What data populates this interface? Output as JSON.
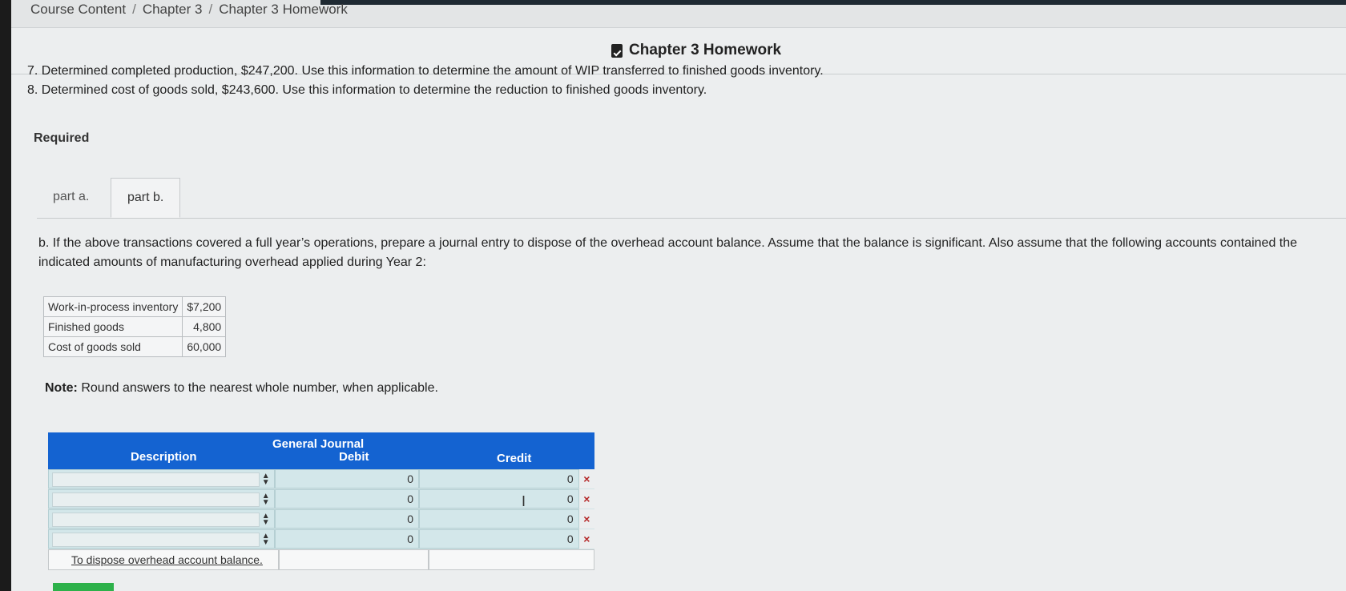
{
  "breadcrumb": {
    "items": [
      "Course Content",
      "Chapter 3",
      "Chapter 3 Homework"
    ],
    "separator": "/"
  },
  "assignment_title": "Chapter 3 Homework",
  "problem_items": [
    "7. Determined completed production, $247,200. Use this information to determine the amount of WIP transferred to finished goods inventory.",
    "8. Determined cost of goods sold, $243,600. Use this information to determine the reduction to finished goods inventory."
  ],
  "required_label": "Required",
  "tabs": [
    {
      "label": "part a."
    },
    {
      "label": "part b."
    }
  ],
  "part_b_text": "b. If the above transactions covered a full year’s operations, prepare a journal entry to dispose of the overhead account balance. Assume that the balance is significant. Also assume that the following accounts contained the indicated amounts of manufacturing overhead applied during Year 2:",
  "accounts_table": [
    {
      "account": "Work-in-process inventory",
      "amount": "$7,200"
    },
    {
      "account": "Finished goods",
      "amount": "4,800"
    },
    {
      "account": "Cost of goods sold",
      "amount": "60,000"
    }
  ],
  "note": {
    "label": "Note:",
    "text": "Round answers to the nearest whole number, when applicable."
  },
  "journal": {
    "title": "General Journal",
    "headers": {
      "description": "Description",
      "debit": "Debit",
      "credit": "Credit"
    },
    "rows": [
      {
        "description": "",
        "debit": "0",
        "credit": "0",
        "status": "×"
      },
      {
        "description": "",
        "debit": "0",
        "credit": "0",
        "status": "×"
      },
      {
        "description": "",
        "debit": "0",
        "credit": "0",
        "status": "×"
      },
      {
        "description": "",
        "debit": "0",
        "credit": "0",
        "status": "×"
      }
    ],
    "memo": "To dispose overhead account balance."
  },
  "colors": {
    "header_blue": "#1463d1",
    "input_teal": "#d3e7ea",
    "error_red": "#b52a2a"
  }
}
